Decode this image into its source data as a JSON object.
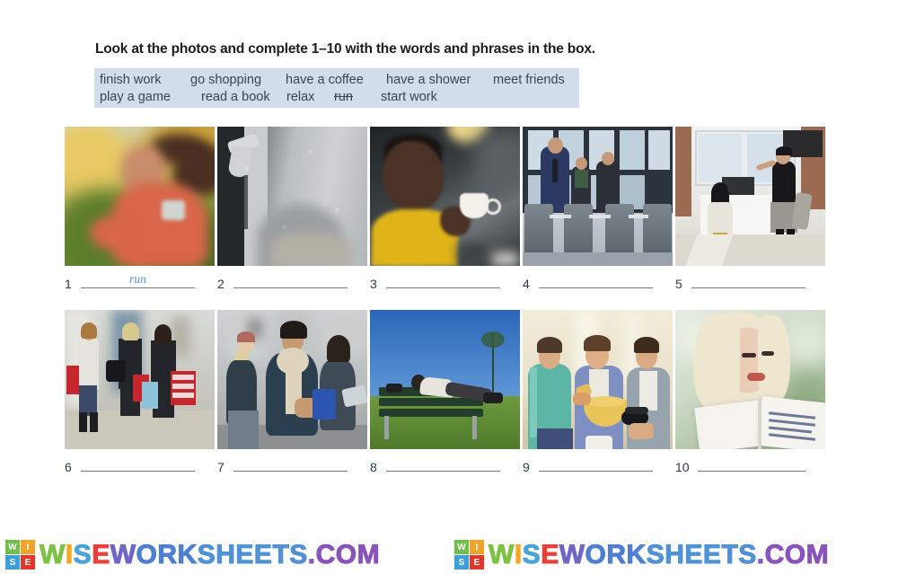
{
  "instruction": "Look at the photos and complete 1–10 with the words and phrases in the box.",
  "word_box": {
    "row1": [
      {
        "text": "finish work",
        "struck": false
      },
      {
        "text": "go shopping",
        "struck": false
      },
      {
        "text": "have a coffee",
        "struck": false
      },
      {
        "text": "have a shower",
        "struck": false
      },
      {
        "text": "meet friends",
        "struck": false
      }
    ],
    "row2": [
      {
        "text": "play a game",
        "struck": false
      },
      {
        "text": "read a book",
        "struck": false
      },
      {
        "text": "relax",
        "struck": false
      },
      {
        "text": "run",
        "struck": true
      },
      {
        "text": "start work",
        "struck": false
      }
    ],
    "background_color": "#d3dcea"
  },
  "items": [
    {
      "number": "1",
      "answer": "run",
      "photo": "woman-jogging-autumn"
    },
    {
      "number": "2",
      "answer": "",
      "photo": "shower-head-steam"
    },
    {
      "number": "3",
      "answer": "",
      "photo": "man-yellow-sweater-coffee-cup"
    },
    {
      "number": "4",
      "answer": "",
      "photo": "business-people-office-turnstiles"
    },
    {
      "number": "5",
      "answer": "",
      "photo": "woman-leaving-office-waving"
    },
    {
      "number": "6",
      "answer": "",
      "photo": "women-shopping-mall-sale-bags"
    },
    {
      "number": "7",
      "answer": "",
      "photo": "friends-sitting-outdoors-winter"
    },
    {
      "number": "8",
      "answer": "",
      "photo": "person-relaxing-park-bench"
    },
    {
      "number": "9",
      "answer": "",
      "photo": "three-men-snacks-game-controller"
    },
    {
      "number": "10",
      "answer": "",
      "photo": "blonde-woman-reading-book"
    }
  ],
  "watermark": {
    "logo_tiles": [
      {
        "letter": "W",
        "color": "#6fbf4a"
      },
      {
        "letter": "I",
        "color": "#f0a32a"
      },
      {
        "letter": "S",
        "color": "#3d9fd8"
      },
      {
        "letter": "E",
        "color": "#e0362c"
      }
    ],
    "letters": [
      {
        "ch": "W",
        "color": "#7dc242"
      },
      {
        "ch": "I",
        "color": "#f5a623"
      },
      {
        "ch": "S",
        "color": "#4ba3d8"
      },
      {
        "ch": "E",
        "color": "#e8403a"
      },
      {
        "ch": "W",
        "color": "#6f66c4"
      },
      {
        "ch": "O",
        "color": "#4f7fd0"
      },
      {
        "ch": "R",
        "color": "#4f7fd0"
      },
      {
        "ch": "K",
        "color": "#4f7fd0"
      },
      {
        "ch": "S",
        "color": "#4f92d6"
      },
      {
        "ch": "H",
        "color": "#4f92d6"
      },
      {
        "ch": "E",
        "color": "#4f92d6"
      },
      {
        "ch": "E",
        "color": "#4f92d6"
      },
      {
        "ch": "T",
        "color": "#5390d4"
      },
      {
        "ch": "S",
        "color": "#5390d4"
      },
      {
        "ch": ".",
        "color": "#7b5fc0"
      },
      {
        "ch": "C",
        "color": "#8a52bd"
      },
      {
        "ch": "O",
        "color": "#8a52bd"
      },
      {
        "ch": "M",
        "color": "#8a52bd"
      }
    ]
  }
}
